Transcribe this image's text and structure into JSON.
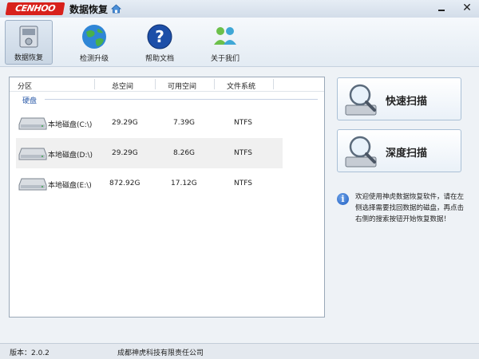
{
  "titlebar": {
    "logo_text": "CENHOO",
    "title": "数据恢复"
  },
  "toolbar": {
    "items": [
      {
        "label": "数据恢复",
        "icon": "data-recovery-icon",
        "active": true
      },
      {
        "label": "检测升级",
        "icon": "globe-update-icon",
        "active": false
      },
      {
        "label": "帮助文档",
        "icon": "help-icon",
        "active": false
      },
      {
        "label": "关于我们",
        "icon": "about-us-icon",
        "active": false
      }
    ]
  },
  "partitions": {
    "columns": [
      "分区",
      "总空间",
      "可用空间",
      "文件系统"
    ],
    "group_label": "硬盘",
    "rows": [
      {
        "name": "本地磁盘(C:\\)",
        "total": "29.29G",
        "free": "7.39G",
        "fs": "NTFS"
      },
      {
        "name": "本地磁盘(D:\\)",
        "total": "29.29G",
        "free": "8.26G",
        "fs": "NTFS"
      },
      {
        "name": "本地磁盘(E:\\)",
        "total": "872.92G",
        "free": "17.12G",
        "fs": "NTFS"
      }
    ]
  },
  "actions": {
    "quick_scan": "快速扫描",
    "deep_scan": "深度扫描"
  },
  "info": {
    "text": "欢迎使用神虎数据恢复软件，请在左侧选择需要找回数据的磁盘，再点击右侧的搜索按钮开始恢复数据！"
  },
  "status": {
    "version": "版本：2.0.2",
    "company": "成都神虎科技有限责任公司"
  },
  "colors": {
    "accent": "#2a5aa8",
    "logo": "#d8211c"
  }
}
